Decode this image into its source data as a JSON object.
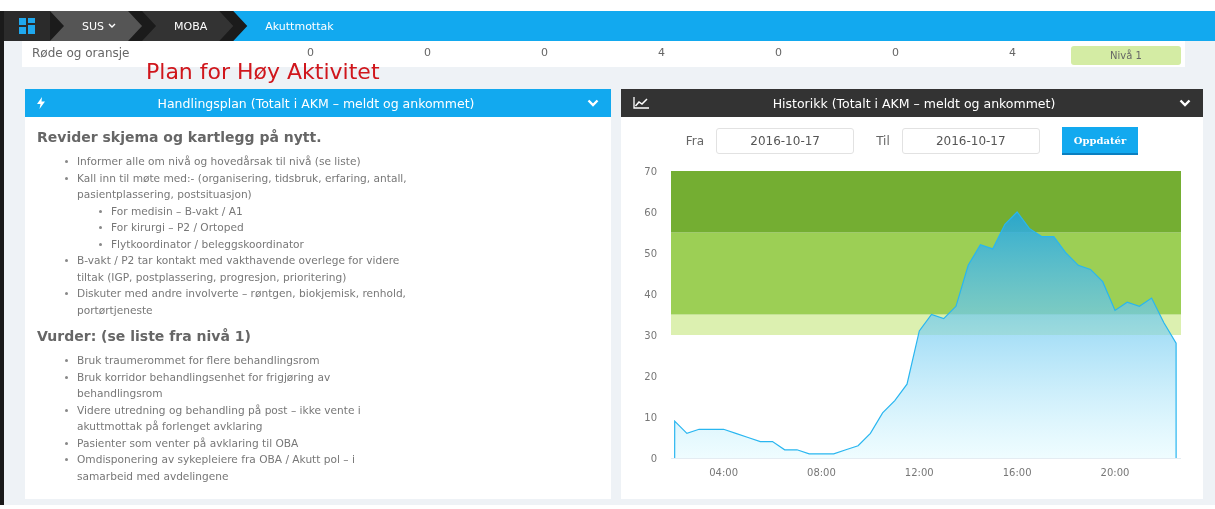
{
  "breadcrumbs": [
    {
      "label": "SUS",
      "dropdown": true,
      "selected": false
    },
    {
      "label": "MOBA",
      "dropdown": false,
      "selected": false
    },
    {
      "label": "Akuttmottak",
      "dropdown": false,
      "selected": true
    }
  ],
  "summary_row": {
    "label": "Røde og oransje",
    "values": [
      "0",
      "0",
      "0",
      "4",
      "0",
      "0",
      "4"
    ],
    "badge": "Nivå 1"
  },
  "overlay_title": "Plan for Høy Aktivitet",
  "action_panel": {
    "title": "Handlingsplan (Totalt i AKM – meldt og ankommet)",
    "sections": [
      {
        "heading": "Revider skjema og kartlegg på nytt.",
        "items": [
          {
            "text": "Informer alle om nivå og hovedårsak til nivå (se liste)"
          },
          {
            "text": "Kall inn til møte med:- (organisering, tidsbruk, erfaring, antall, pasientplassering, postsituasjon)",
            "children": [
              {
                "text": "For medisin – B-vakt / A1"
              },
              {
                "text": "For kirurgi – P2 / Ortoped"
              },
              {
                "text": "Flytkoordinator / beleggskoordinator"
              }
            ]
          },
          {
            "text": "B-vakt / P2 tar kontakt med vakthavende overlege for videre tiltak (IGP, postplassering, progresjon, prioritering)"
          },
          {
            "text": "Diskuter med andre involverte – røntgen, biokjemisk, renhold, portørtjeneste"
          }
        ]
      },
      {
        "heading": "Vurder: (se liste fra nivå 1)",
        "items": [
          {
            "text": "Bruk traumerommet for flere behandlingsrom"
          },
          {
            "text": "Bruk korridor behandlingsenhet for frigjøring av behandlingsrom"
          },
          {
            "text": "Videre utredning og behandling på post – ikke vente i akuttmottak på forlenget avklaring"
          },
          {
            "text": "Pasienter som venter på avklaring til OBA"
          },
          {
            "text": "Omdisponering av sykepleiere fra OBA / Akutt pol – i samarbeid med avdelingene"
          }
        ]
      }
    ]
  },
  "history_panel": {
    "title": "Historikk (Totalt i AKM – meldt og ankommet)",
    "from_label": "Fra",
    "from_value": "2016-10-17",
    "to_label": "Til",
    "to_value": "2016-10-17",
    "button": "Oppdatér",
    "chart_data": {
      "type": "area",
      "x": [
        2,
        2.5,
        3,
        3.5,
        4,
        4.5,
        5,
        5.5,
        6,
        6.5,
        7,
        7.5,
        8,
        8.5,
        9,
        9.5,
        10,
        10.5,
        11,
        11.5,
        12,
        12.5,
        13,
        13.5,
        14,
        14.5,
        15,
        15.5,
        16,
        16.5,
        17,
        17.5,
        18,
        18.5,
        19,
        19.5,
        20,
        20.5,
        21,
        21.5,
        22,
        22.5
      ],
      "series": [
        {
          "color": "#29b6f0",
          "values": [
            9,
            6,
            7,
            7,
            7,
            6,
            5,
            4,
            4,
            2,
            2,
            1,
            1,
            1,
            2,
            3,
            6,
            11,
            14,
            18,
            31,
            35,
            34,
            37,
            47,
            52,
            51,
            57,
            60,
            56,
            54,
            54,
            50,
            47,
            46,
            43,
            36,
            38,
            37,
            39,
            33,
            28
          ]
        }
      ],
      "xlim": [
        1.85,
        22.7
      ],
      "ylim": [
        0,
        70
      ],
      "xticks": [
        {
          "value": 4,
          "label": "04:00"
        },
        {
          "value": 8,
          "label": "08:00"
        },
        {
          "value": 12,
          "label": "12:00"
        },
        {
          "value": 16,
          "label": "16:00"
        },
        {
          "value": 20,
          "label": "20:00"
        }
      ],
      "yticks": [
        0,
        10,
        20,
        30,
        40,
        50,
        60,
        70
      ],
      "bands": [
        {
          "axis": "y",
          "from": 30,
          "to": 35,
          "color": "#dcf0b0"
        },
        {
          "axis": "y",
          "from": 35,
          "to": 55,
          "color": "#9ccf55"
        },
        {
          "axis": "y",
          "from": 55,
          "to": 70,
          "color": "#74ae32"
        }
      ]
    }
  }
}
